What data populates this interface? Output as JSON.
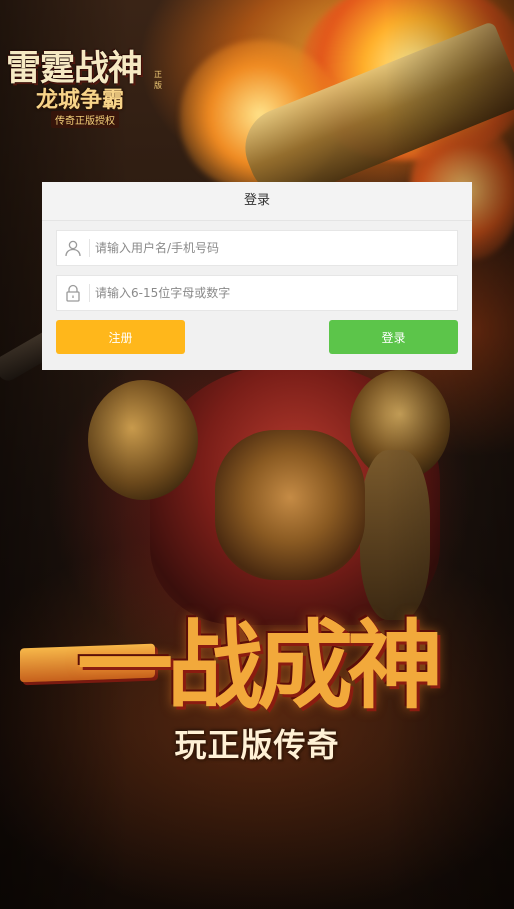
{
  "logo": {
    "title": "雷霆战神",
    "subtitle": "龙城争霸",
    "tagline": "传奇正版授权",
    "corner_mark": "正版"
  },
  "login_panel": {
    "title": "登录",
    "username": {
      "placeholder": "请输入用户名/手机号码",
      "value": ""
    },
    "password": {
      "placeholder": "请输入6-15位字母或数字",
      "value": ""
    },
    "register_label": "注册",
    "login_label": "登录"
  },
  "banner": {
    "slogan": "一战成神",
    "sub_slogan": "玩正版传奇"
  },
  "colors": {
    "register_button": "#ffb71b",
    "login_button": "#5cc54a",
    "panel_bg": "#f1f1f1"
  },
  "icons": {
    "username": "user-icon",
    "password": "lock-icon"
  }
}
